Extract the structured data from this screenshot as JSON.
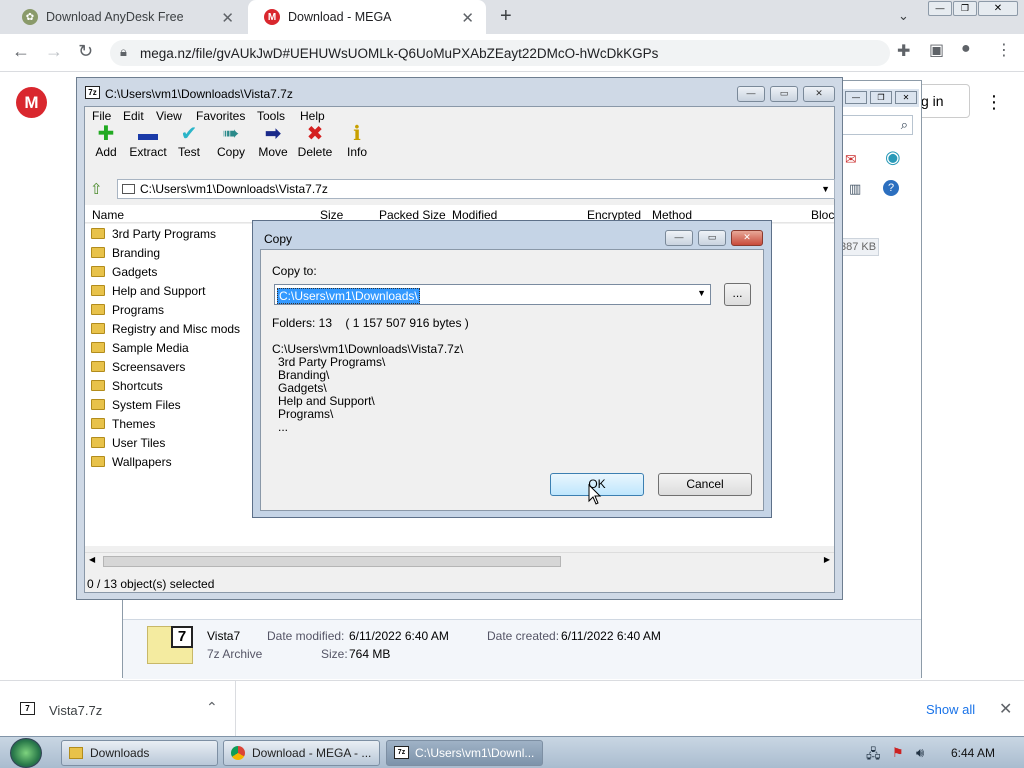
{
  "browser": {
    "tabs": [
      {
        "title": "Download AnyDesk Free",
        "favicon": "anydesk-icon"
      },
      {
        "title": "Download - MEGA",
        "favicon": "mega-icon"
      }
    ],
    "url": "mega.nz/file/gvAUkJwD#UEHUWsUOMLk-Q6UoMuPXAbZEayt22DMcO-hWcDkKGPs",
    "page_signin": "g in"
  },
  "zip": {
    "title": "C:\\Users\\vm1\\Downloads\\Vista7.7z",
    "menu": [
      "File",
      "Edit",
      "View",
      "Favorites",
      "Tools",
      "Help"
    ],
    "tools": [
      {
        "label": "Add",
        "icon": "plus-icon",
        "color": "#22aa22"
      },
      {
        "label": "Extract",
        "icon": "minus-icon",
        "color": "#1a3aa8"
      },
      {
        "label": "Test",
        "icon": "check-icon",
        "color": "#2bb5c8"
      },
      {
        "label": "Copy",
        "icon": "double-arrow-icon",
        "color": "#2a8a8a"
      },
      {
        "label": "Move",
        "icon": "arrow-right-icon",
        "color": "#1a2a8a"
      },
      {
        "label": "Delete",
        "icon": "x-icon",
        "color": "#d42020"
      },
      {
        "label": "Info",
        "icon": "info-icon",
        "color": "#c8a000"
      }
    ],
    "address": "C:\\Users\\vm1\\Downloads\\Vista7.7z",
    "columns": [
      "Name",
      "Size",
      "Packed Size",
      "Modified",
      "Encrypted",
      "Method",
      "Bloc"
    ],
    "folders": [
      "3rd Party Programs",
      "Branding",
      "Gadgets",
      "Help and Support",
      "Programs",
      "Registry and Misc mods",
      "Sample Media",
      "Screensavers",
      "Shortcuts",
      "System Files",
      "Themes",
      "User Tiles",
      "Wallpapers"
    ],
    "status": "0 / 13 object(s) selected"
  },
  "dialog": {
    "title": "Copy",
    "copy_to_label": "Copy to:",
    "copy_to_value": "C:\\Users\\vm1\\Downloads\\",
    "browse": "...",
    "folders_info": "Folders: 13    ( 1 157 507 916 bytes )",
    "path": "C:\\Users\\vm1\\Downloads\\Vista7.7z\\",
    "items": [
      "3rd Party Programs\\",
      "Branding\\",
      "Gadgets\\",
      "Help and Support\\",
      "Programs\\",
      "..."
    ],
    "ok": "OK",
    "cancel": "Cancel"
  },
  "explorer": {
    "size_badge": "387 KB",
    "file_name": "Vista7",
    "file_type": "7z Archive",
    "date_modified_label": "Date modified:",
    "date_modified": "6/11/2022 6:40 AM",
    "date_created_label": "Date created:",
    "date_created": "6/11/2022 6:40 AM",
    "size_label": "Size:",
    "size": "764 MB"
  },
  "shelf": {
    "file": "Vista7.7z",
    "show_all": "Show all"
  },
  "taskbar": {
    "items": [
      "Downloads",
      "Download - MEGA - ...",
      "C:\\Users\\vm1\\Downl..."
    ],
    "time": "6:44 AM"
  }
}
